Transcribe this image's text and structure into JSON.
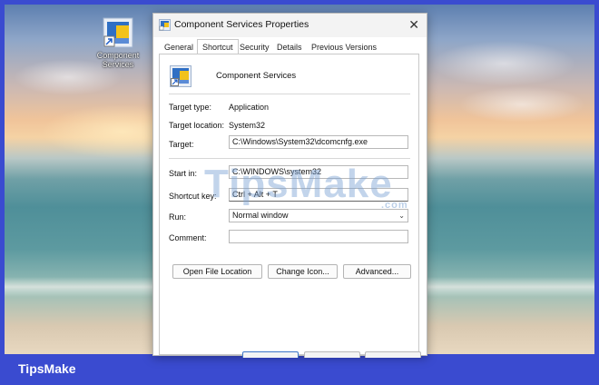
{
  "desktop": {
    "icon_label_line1": "Component",
    "icon_label_line2": "Services"
  },
  "dialog": {
    "title": "Component Services  Properties",
    "close_glyph": "✕",
    "tabs": [
      {
        "label": "General"
      },
      {
        "label": "Shortcut"
      },
      {
        "label": "Security"
      },
      {
        "label": "Details"
      },
      {
        "label": "Previous Versions"
      }
    ],
    "active_tab": "Shortcut",
    "app_name": "Component Services",
    "target_type_label": "Target type:",
    "target_type_value": "Application",
    "target_location_label": "Target location:",
    "target_location_value": "System32",
    "target_label": "Target:",
    "target_value": "C:\\Windows\\System32\\dcomcnfg.exe",
    "start_in_label": "Start in:",
    "start_in_value": "C:\\WINDOWS\\system32",
    "shortcut_key_label": "Shortcut key:",
    "shortcut_key_value": "Ctrl + Alt + T",
    "run_label": "Run:",
    "run_value": "Normal window",
    "comment_label": "Comment:",
    "comment_value": "",
    "buttons": {
      "open_file_location": "Open File Location",
      "change_icon": "Change Icon...",
      "advanced": "Advanced..."
    }
  },
  "watermark": {
    "text": "TipsMake",
    "suffix": ".com"
  },
  "brand": "TipsMake",
  "colors": {
    "frame": "#3a4bd0",
    "accent": "#3e77c8"
  }
}
